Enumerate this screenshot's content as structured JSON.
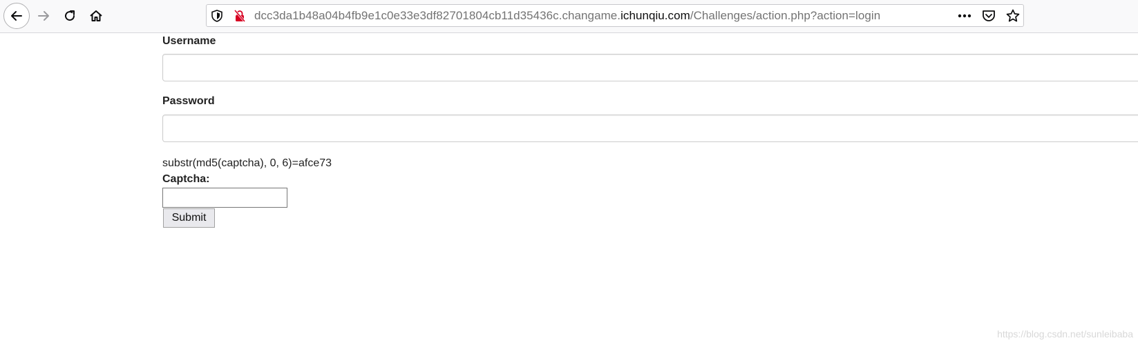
{
  "browser": {
    "url_prefix": "dcc3da1b48a04b4fb9e1c0e33e3df82701804cb11d35436c.changame.",
    "url_domain": "ichunqiu.com",
    "url_path": "/Challenges/action.php?action=login",
    "icons": {
      "back": "arrow-left-icon",
      "forward": "arrow-right-icon",
      "reload": "reload-icon",
      "home": "home-icon",
      "tracking": "shield-icon",
      "security": "not-secure-lock-icon",
      "more": "more-dots-icon",
      "pocket": "pocket-icon",
      "bookmark": "star-icon"
    }
  },
  "form": {
    "username_label": "Username",
    "username_value": "",
    "password_label": "Password",
    "password_value": "",
    "captcha_hint": "substr(md5(captcha), 0, 6)=afce73",
    "captcha_label": "Captcha:",
    "captcha_value": "",
    "submit_label": "Submit"
  },
  "watermark": "https://blog.csdn.net/sunleibaba",
  "colors": {
    "toolbar_bg": "#f9f9fa",
    "url_grey": "#737373",
    "url_domain": "#0c0c0d",
    "insecure_red": "#d70022"
  }
}
